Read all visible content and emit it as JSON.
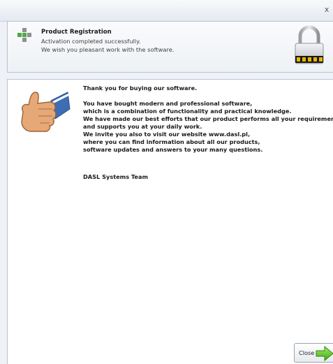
{
  "header": {
    "title": "Product Registration",
    "line1": "Activation completed successfully.",
    "line2": "We wish you pleasant work with the software."
  },
  "window": {
    "close_glyph": "x"
  },
  "icons": {
    "header_left": "plus-icon",
    "header_right": "padlock-icon",
    "content_left": "thumbs-up-icon",
    "button": "green-arrow-right-icon"
  },
  "message": {
    "thanks": "Thank you for buying our software.",
    "p1": "You have bought modern and professional software,",
    "p2": "which is a combination of functionality and practical knowledge.",
    "p3": "We have made our best efforts that our product performs all your requirements",
    "p4": "and supports you at your daily work.",
    "p5": "We invite you also to visit our website www.dasl.pl,",
    "p6": "where you can find information about all our products,",
    "p7": "software updates and answers to your many questions.",
    "signature": "DASL Systems Team"
  },
  "buttons": {
    "close_label": "Close"
  },
  "colors": {
    "accent_green": "#5cc42a",
    "lock_stripe": "#e8b400",
    "thumb_sleeve": "#3f6db3",
    "plus_green": "#4ea84a",
    "plus_gray": "#8f8f8f"
  }
}
